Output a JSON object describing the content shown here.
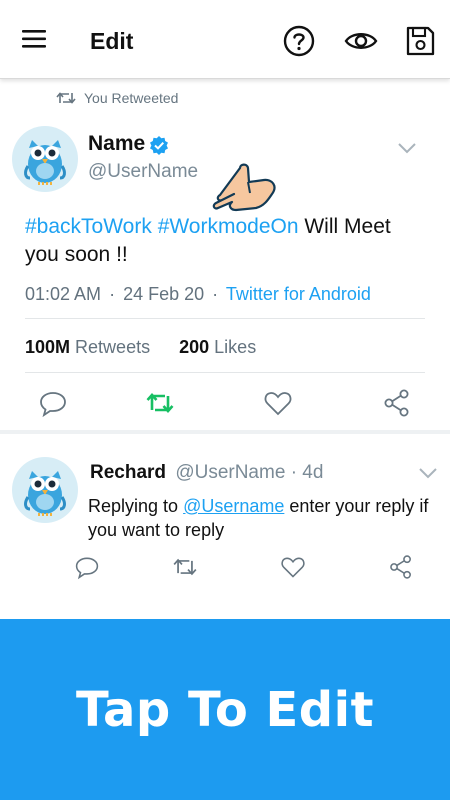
{
  "appbar": {
    "title": "Edit",
    "icons": [
      "menu-icon",
      "help-icon",
      "eye-icon",
      "save-icon"
    ]
  },
  "tweet": {
    "retweet_label": "You Retweeted",
    "author_name": "Name",
    "author_handle": "@UserName",
    "text_hashtag_1": "#backToWork",
    "text_hashtag_2": "#WorkmodeOn",
    "text_rest": " Will Meet you soon !!",
    "time": "01:02 AM",
    "date": "24 Feb 20",
    "source": "Twitter for Android",
    "retweets_count": "100M",
    "retweets_label": "Retweets",
    "likes_count": "200",
    "likes_label": "Likes"
  },
  "reply": {
    "author_name": "Rechard",
    "author_handle": "@UserName",
    "age": "4d",
    "text_prefix": "Replying to ",
    "mention": "@Username",
    "text_suffix": " enter your reply if you want to reply"
  },
  "banner": {
    "text": "Tap To Edit"
  },
  "colors": {
    "accent": "#1da1f2",
    "retweet_green": "#17bf63",
    "banner_bg": "#1d9bf0"
  }
}
